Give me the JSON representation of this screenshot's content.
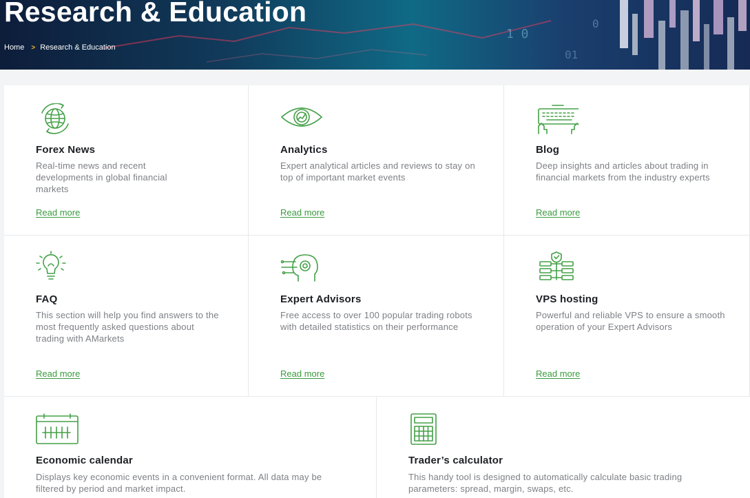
{
  "header": {
    "title": "Research & Education",
    "breadcrumb": {
      "home": "Home",
      "separator": ">",
      "current": "Research & Education"
    }
  },
  "colors": {
    "accent": "#43a047",
    "link": "#3a9a3e",
    "breadcrumb_separator": "#f2b233"
  },
  "cards": [
    {
      "icon": "globe-refresh-icon",
      "title": "Forex News",
      "description": "Real-time news and recent developments in global financial markets",
      "link": "Read more"
    },
    {
      "icon": "eye-chart-icon",
      "title": "Analytics",
      "description": "Expert analytical articles and reviews to stay on top of important market events",
      "link": "Read more"
    },
    {
      "icon": "keyboard-hands-icon",
      "title": "Blog",
      "description": "Deep insights and articles about trading in financial markets from the industry experts",
      "link": "Read more"
    },
    {
      "icon": "lightbulb-icon",
      "title": "FAQ",
      "description": "This section will help you find answers to the most frequently asked questions about trading with AMarkets",
      "link": "Read more"
    },
    {
      "icon": "robot-head-icon",
      "title": "Expert Advisors",
      "description": "Free access to over 100 popular trading robots with detailed statistics on their performance",
      "link": "Read more"
    },
    {
      "icon": "server-shield-icon",
      "title": "VPS hosting",
      "description": "Powerful and reliable VPS to ensure a smooth operation of your Expert Advisors",
      "link": "Read more"
    },
    {
      "icon": "calendar-icon",
      "title": "Economic calendar",
      "description": "Displays key economic events in a convenient format. All data may be filtered by period and market impact."
    },
    {
      "icon": "calculator-icon",
      "title": "Trader’s calculator",
      "description": "This handy tool is designed to automatically calculate basic trading parameters: spread, margin, swaps, etc."
    }
  ]
}
